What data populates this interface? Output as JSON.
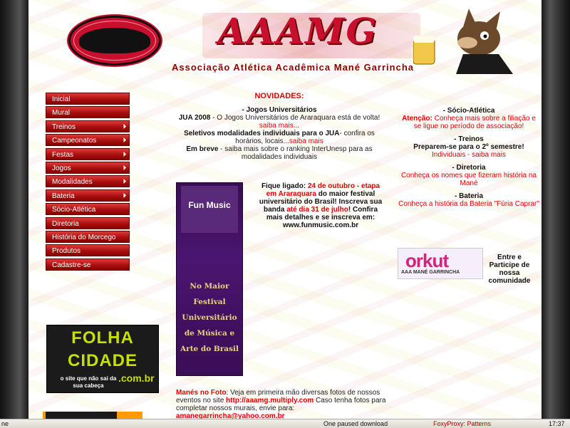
{
  "header": {
    "title": "AAAMG",
    "subtitle": "Associação Atlética Acadêmica Mané Garrincha"
  },
  "menu": {
    "items": [
      {
        "label": "Inicial",
        "has_arrow": false
      },
      {
        "label": "Mural",
        "has_arrow": false
      },
      {
        "label": "Treinos",
        "has_arrow": true
      },
      {
        "label": "Campeonatos",
        "has_arrow": true
      },
      {
        "label": "Festas",
        "has_arrow": true
      },
      {
        "label": "Jogos",
        "has_arrow": true
      },
      {
        "label": "Modalidades",
        "has_arrow": true
      },
      {
        "label": "Bateria",
        "has_arrow": true
      },
      {
        "label": "Sócio-Atlética",
        "has_arrow": false
      },
      {
        "label": "Diretoria",
        "has_arrow": false
      },
      {
        "label": "História do Morcego",
        "has_arrow": false
      },
      {
        "label": "Produtos",
        "has_arrow": false
      },
      {
        "label": "Cadastre-se",
        "has_arrow": false
      }
    ]
  },
  "ad_folha": {
    "line1": "FOLHA",
    "line2": "CIDADE",
    "tagline": "o site que não sai da sua cabeça",
    "domain": ".com.br"
  },
  "news": {
    "heading": "NOVIDADES:",
    "jogos_title": "- Jogos Universitários",
    "jua_lead": "JUA 2008",
    "jua_text": " - O Jogos Universitários de Araraquara está de volta! ",
    "jua_link": "saiba mais...",
    "seletivos_bold": "Seletivos modalidades individuais para o JUA",
    "seletivos_text": "- confira os horários, locais...",
    "seletivos_link": "saiba mais",
    "embreve_bold": "Em breve",
    "embreve_text": " - saiba mais sobre o ranking InterUnesp para as modalidades individuais"
  },
  "festival": {
    "logo": "Fun Music",
    "text": "No Maior Festival Universitário de Música e Arte do Brasil",
    "p1_a": "Fique ligado: ",
    "p1_red": "24 de outubro - etapa em Araraquara",
    "p1_b": " do maior festival universitário do Brasil! Inscreva sua banda ",
    "p1_red2": "até dia 31 de julho",
    "p1_c": "! Confira mais detalhes e se inscreva em: www.funmusic.com.br"
  },
  "bottom_news": {
    "lead": "Manés no Foto",
    "text": ": Veja em primeira mão diversas fotos de nossos eventos no site ",
    "link": "http://aaamg.multiply.com",
    "text2": " Caso tenha fotos para completar nossos murais, envie para: ",
    "email": "amanegarrincha@yahoo.com.br"
  },
  "right": {
    "socio_title": "- Sócio-Atlética",
    "socio_attn": "Atenção:",
    "socio_text": " Conheça mais sobre a filiação e se ligue no período de associação!",
    "treinos_title": "- Treinos",
    "treinos_bold": "Preparem-se para o 2º semestre!",
    "treinos_text": "Individuais - saiba mais",
    "diretoria_title": "- Diretoria",
    "diretoria_text": "Conheça os nomes que fizeram história na Mané",
    "bateria_title": "- Bateria",
    "bateria_text": "Conheça a história da Bateria \"Fúria Caprar\""
  },
  "orkut": {
    "word": "orkut",
    "sub": "AAA MANÉ GARRINCHA",
    "side": "Entre e Participe de nossa comunidade"
  },
  "taskbar": {
    "left": "ne",
    "download": "One paused download",
    "foxy": "FoxyProxy: Patterns",
    "clock": "17:37"
  },
  "colors": {
    "accent": "#e00000",
    "menu": "#a80f0f",
    "folha_green": "#c7e000",
    "festival_purple": "#3a0d55"
  }
}
